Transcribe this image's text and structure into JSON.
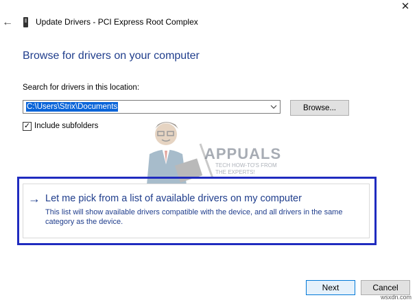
{
  "window": {
    "title": "Update Drivers - PCI Express Root Complex",
    "close_glyph": "✕",
    "back_glyph": "←"
  },
  "page": {
    "heading": "Browse for drivers on your computer",
    "search_label": "Search for drivers in this location:",
    "path_value": "C:\\Users\\Strix\\Documents",
    "browse_label": "Browse...",
    "include_subfolders_label": "Include subfolders",
    "include_subfolders_checked": true,
    "check_glyph": "✓"
  },
  "option": {
    "arrow_glyph": "→",
    "title": "Let me pick from a list of available drivers on my computer",
    "description": "This list will show available drivers compatible with the device, and all drivers in the same category as the device."
  },
  "buttons": {
    "next_label": "Next",
    "cancel_label": "Cancel"
  },
  "watermark": {
    "brand": "APPUALS",
    "tagline_line1": "TECH HOW-TO'S FROM",
    "tagline_line2": "THE EXPERTS!",
    "site": "wsxdn.com"
  },
  "colors": {
    "heading_blue": "#1f3d8c",
    "highlight_border": "#1f2bbf",
    "selection_blue": "#0a64d8",
    "primary_button_border": "#0078d7"
  }
}
